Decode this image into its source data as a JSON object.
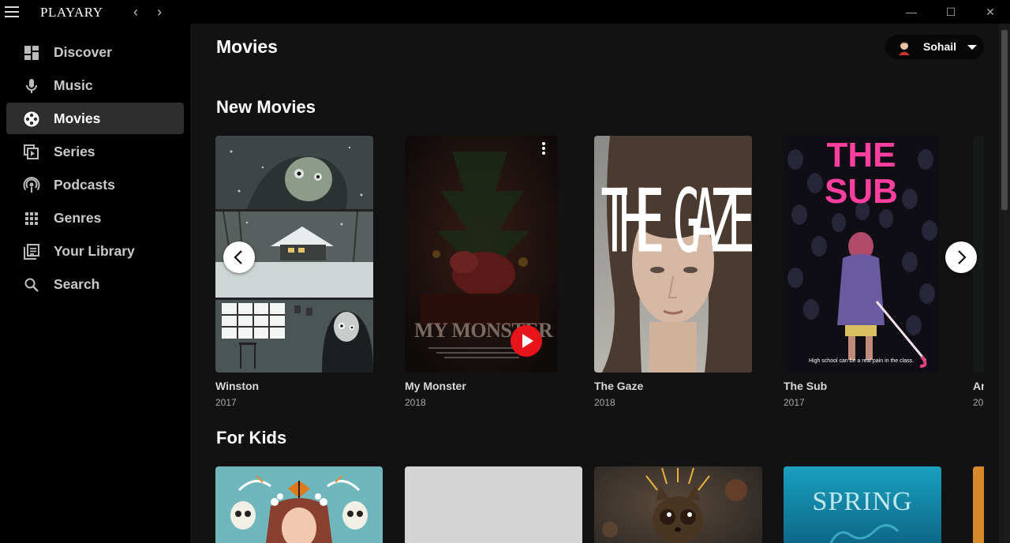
{
  "app": {
    "title": "PLAYARY"
  },
  "window": {
    "minimize": "—",
    "maximize": "☐",
    "close": "✕"
  },
  "nav": {
    "back": "‹",
    "forward": "›",
    "items": [
      {
        "label": "Discover",
        "icon": "dashboard-icon"
      },
      {
        "label": "Music",
        "icon": "microphone-icon"
      },
      {
        "label": "Movies",
        "icon": "film-reel-icon",
        "active": true
      },
      {
        "label": "Series",
        "icon": "series-stack-icon"
      },
      {
        "label": "Podcasts",
        "icon": "podcast-icon"
      },
      {
        "label": "Genres",
        "icon": "grid-icon"
      },
      {
        "label": "Your Library",
        "icon": "library-icon"
      },
      {
        "label": "Search",
        "icon": "search-icon"
      }
    ]
  },
  "header": {
    "title": "Movies",
    "user": {
      "name": "Sohail"
    }
  },
  "sections": [
    {
      "title": "New Movies",
      "cards": [
        {
          "title": "Winston",
          "year": "2017"
        },
        {
          "title": "My Monster",
          "year": "2018",
          "poster_text": "MY MONSTER"
        },
        {
          "title": "The Gaze",
          "year": "2018",
          "poster_text": "THE GAZE"
        },
        {
          "title": "The Sub",
          "year": "2017",
          "poster_text": "THE SUB",
          "poster_tagline": "High school can be a real pain in the class."
        },
        {
          "title": "An",
          "year": "20"
        }
      ]
    },
    {
      "title": "For Kids",
      "cards": [
        {
          "title": ""
        },
        {
          "title": ""
        },
        {
          "title": ""
        },
        {
          "title": "",
          "poster_text": "SPRING"
        },
        {
          "title": ""
        }
      ]
    }
  ],
  "colors": {
    "accent_red": "#e8141c",
    "main_bg": "#121212",
    "sidebar_bg": "#000000",
    "active_item": "#2e2e2e"
  }
}
